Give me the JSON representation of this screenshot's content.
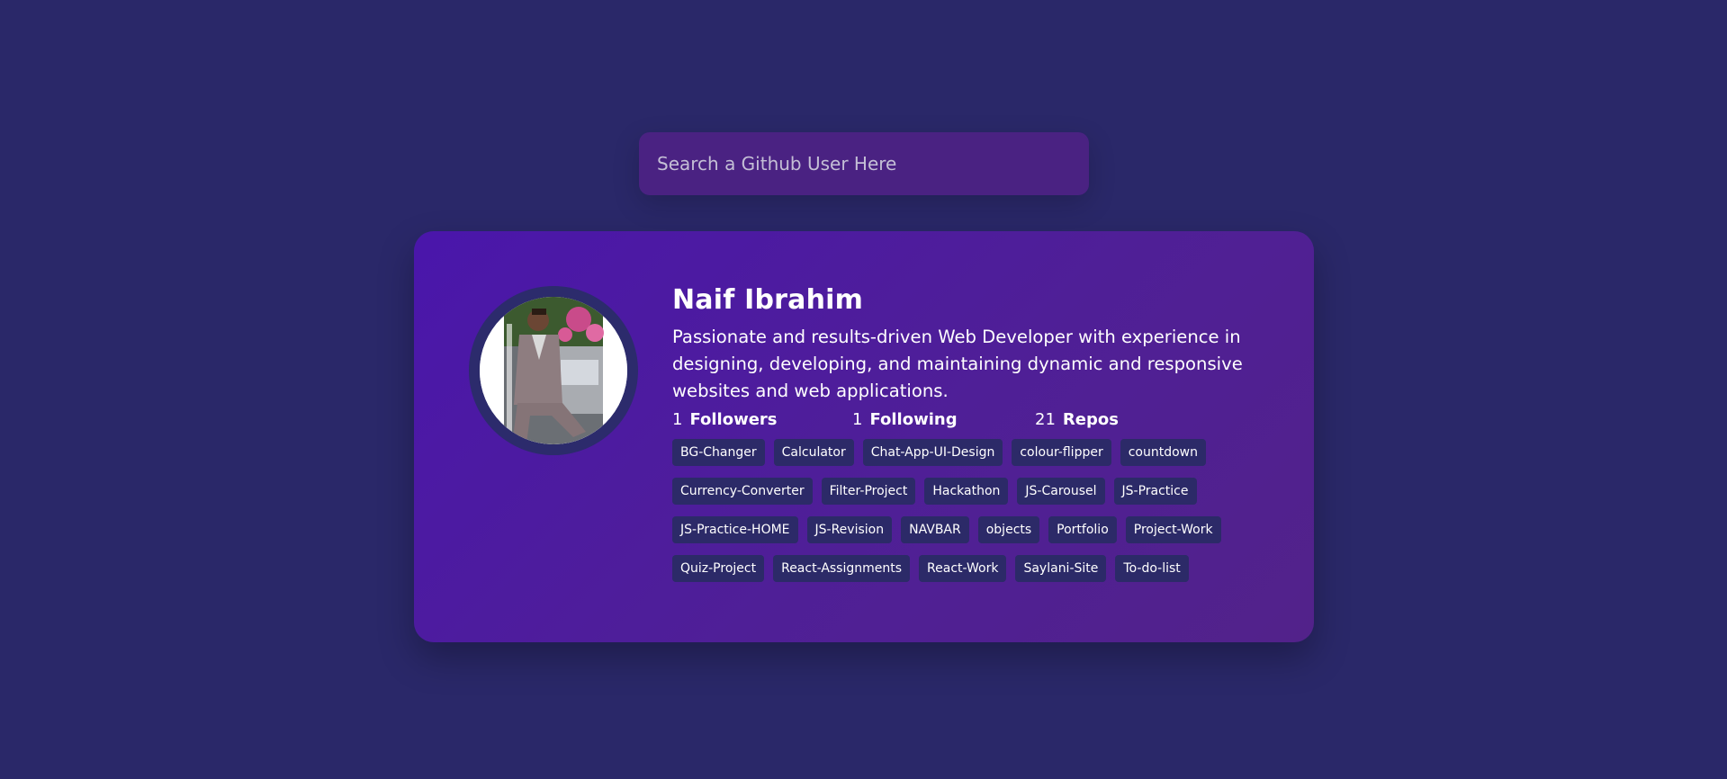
{
  "search": {
    "placeholder": "Search a Github User Here"
  },
  "profile": {
    "name": "Naif Ibrahim",
    "bio": "Passionate and results-driven Web Developer with experience in designing, developing, and maintaining dynamic and responsive websites and web applications.",
    "stats": {
      "followers_count": "1",
      "followers_label": "Followers",
      "following_count": "1",
      "following_label": "Following",
      "repos_count": "21",
      "repos_label": "Repos"
    },
    "repos": [
      "BG-Changer",
      "Calculator",
      "Chat-App-UI-Design",
      "colour-flipper",
      "countdown",
      "Currency-Converter",
      "Filter-Project",
      "Hackathon",
      "JS-Carousel",
      "JS-Practice",
      "JS-Practice-HOME",
      "JS-Revision",
      "NAVBAR",
      "objects",
      "Portfolio",
      "Project-Work",
      "Quiz-Project",
      "React-Assignments",
      "React-Work",
      "Saylani-Site",
      "To-do-list"
    ]
  },
  "colors": {
    "page_background": "#2a2869",
    "card_gradient_start": "#4a16ab",
    "card_gradient_end": "#52228a",
    "repo_tag_background": "#2c2a68",
    "search_background": "#4a2282",
    "text": "#ffffff"
  }
}
